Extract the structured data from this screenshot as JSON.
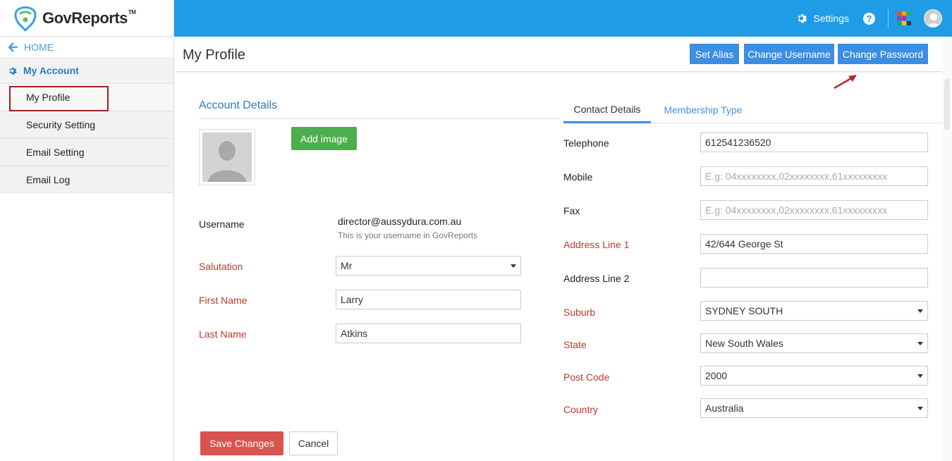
{
  "brand": {
    "name": "GovReports",
    "tm": "TM"
  },
  "topbar": {
    "settings_label": "Settings",
    "help_label": "?"
  },
  "sidebar": {
    "home_label": "HOME",
    "section_label": "My Account",
    "items": [
      {
        "label": "My Profile",
        "active": true
      },
      {
        "label": "Security Setting"
      },
      {
        "label": "Email Setting"
      },
      {
        "label": "Email Log"
      }
    ]
  },
  "header": {
    "title": "My Profile",
    "buttons": {
      "set_alias": "Set Alias",
      "change_username": "Change Username",
      "change_password": "Change Password"
    }
  },
  "account": {
    "section_title": "Account Details",
    "add_image_label": "Add image",
    "username_label": "Username",
    "username_value": "director@aussydura.com.au",
    "username_hint": "This is your username in GovReports",
    "salutation_label": "Salutation",
    "salutation_value": "Mr",
    "first_name_label": "First Name",
    "first_name_value": "Larry",
    "last_name_label": "Last Name",
    "last_name_value": "Atkins"
  },
  "tabs": {
    "contact": "Contact Details",
    "membership": "Membership Type"
  },
  "contact": {
    "telephone_label": "Telephone",
    "telephone_value": "612541236520",
    "mobile_label": "Mobile",
    "mobile_placeholder": "E.g: 04xxxxxxxx,02xxxxxxxx,61xxxxxxxxx",
    "fax_label": "Fax",
    "fax_placeholder": "E.g: 04xxxxxxxx,02xxxxxxxx,61xxxxxxxxx",
    "address1_label": "Address Line 1",
    "address1_value": "42/644 George St",
    "address2_label": "Address Line 2",
    "address2_value": "",
    "suburb_label": "Suburb",
    "suburb_value": "SYDNEY SOUTH",
    "state_label": "State",
    "state_value": "New South Wales",
    "postcode_label": "Post Code",
    "postcode_value": "2000",
    "country_label": "Country",
    "country_value": "Australia"
  },
  "actions": {
    "save_label": "Save Changes",
    "cancel_label": "Cancel"
  },
  "colors": {
    "topbar": "#1e9ce6",
    "primary_button": "#3b8ee3",
    "success": "#4cae4c",
    "danger": "#d9534f",
    "required_label": "#c0392b",
    "highlight": "#a51e22"
  }
}
